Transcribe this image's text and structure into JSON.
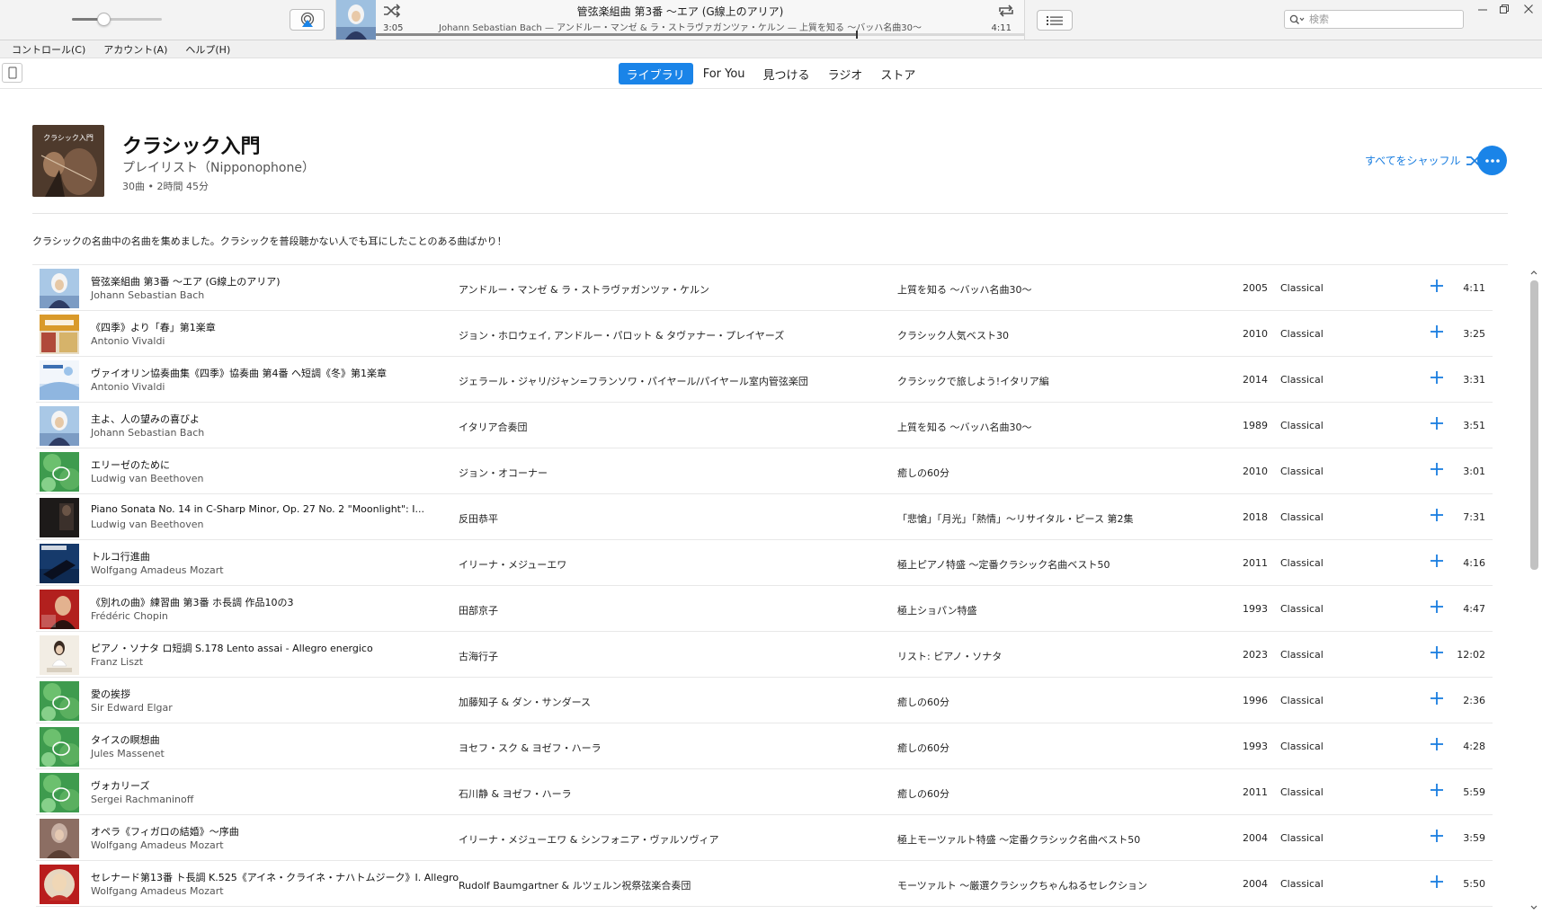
{
  "player": {
    "elapsed": "3:05",
    "remaining": "4:11",
    "title": "管弦楽組曲 第3番 ～エア (G線上のアリア)",
    "subtitle": "Johann Sebastian Bach — アンドルー・マンゼ & ラ・ストラヴァガンツァ・ケルン — 上質を知る ～バッハ名曲30～",
    "progress": 0.74,
    "volume": 0.35
  },
  "search": {
    "placeholder": "検索"
  },
  "menu": [
    "コントロール(C)",
    "アカウント(A)",
    "ヘルプ(H)"
  ],
  "nav": {
    "tabs": [
      {
        "label": "ライブラリ",
        "active": true
      },
      {
        "label": "For You",
        "active": false
      },
      {
        "label": "見つける",
        "active": false
      },
      {
        "label": "ラジオ",
        "active": false
      },
      {
        "label": "ストア",
        "active": false
      }
    ]
  },
  "playlist": {
    "art_text": "クラシック入門",
    "title": "クラシック入門",
    "subtitle": "プレイリスト（Nipponophone）",
    "meta": "30曲 • 2時間 45分",
    "shuffle_label": "すべてをシャッフル",
    "description": "クラシックの名曲中の名曲を集めました。クラシックを普段聴かない人でも耳にしたことのある曲ばかり！"
  },
  "colors": {
    "accent": "#1a84e8",
    "link": "#1a7ee0"
  },
  "tracks": [
    {
      "name": "管弦楽組曲 第3番 ～エア (G線上のアリア)",
      "composer": "Johann Sebastian Bach",
      "artist": "アンドルー・マンゼ & ラ・ストラヴァガンツァ・ケルン",
      "album": "上質を知る ～バッハ名曲30～",
      "year": "2005",
      "genre": "Classical",
      "duration": "4:11",
      "art": "bach"
    },
    {
      "name": "《四季》より「春」第1楽章",
      "composer": "Antonio Vivaldi",
      "artist": "ジョン・ホロウェイ, アンドルー・パロット & タヴァナー・プレイヤーズ",
      "album": "クラシック人気ベスト30",
      "year": "2010",
      "genre": "Classical",
      "duration": "3:25",
      "art": "classicbest"
    },
    {
      "name": "ヴァイオリン協奏曲集《四季》協奏曲 第4番 ヘ短調《冬》第1楽章",
      "composer": "Antonio Vivaldi",
      "artist": "ジェラール・ジャリ/ジャン=フランソワ・パイヤール/パイヤール室内管弦楽団",
      "album": "クラシックで旅しよう!イタリア編",
      "year": "2014",
      "genre": "Classical",
      "duration": "3:31",
      "art": "italy"
    },
    {
      "name": "主よ、人の望みの喜びよ",
      "composer": "Johann Sebastian Bach",
      "artist": "イタリア合奏団",
      "album": "上質を知る ～バッハ名曲30～",
      "year": "1989",
      "genre": "Classical",
      "duration": "3:51",
      "art": "bach"
    },
    {
      "name": "エリーゼのために",
      "composer": "Ludwig van Beethoven",
      "artist": "ジョン・オコーナー",
      "album": "癒しの60分",
      "year": "2010",
      "genre": "Classical",
      "duration": "3:01",
      "art": "green60"
    },
    {
      "name": "Piano Sonata No. 14 in C-Sharp Minor, Op. 27 No. 2 \"Moonlight\": I...",
      "composer": "Ludwig van Beethoven",
      "artist": "反田恭平",
      "album": "「悲愴」「月光」「熱情」～リサイタル・ピース 第2集",
      "year": "2018",
      "genre": "Classical",
      "duration": "7:31",
      "art": "dark"
    },
    {
      "name": "トルコ行進曲",
      "composer": "Wolfgang Amadeus Mozart",
      "artist": "イリーナ・メジューエワ",
      "album": "極上ピアノ特盛 ～定番クラシック名曲ベスト50",
      "year": "2011",
      "genre": "Classical",
      "duration": "4:16",
      "art": "piano"
    },
    {
      "name": "《別れの曲》練習曲 第3番 ホ長調 作品10の3",
      "composer": "Frédéric Chopin",
      "artist": "田部京子",
      "album": "極上ショパン特盛",
      "year": "1993",
      "genre": "Classical",
      "duration": "4:47",
      "art": "chopin"
    },
    {
      "name": "ピアノ・ソナタ ロ短調 S.178 Lento assai - Allegro energico",
      "composer": "Franz Liszt",
      "artist": "古海行子",
      "album": "リスト: ピアノ・ソナタ",
      "year": "2023",
      "genre": "Classical",
      "duration": "12:02",
      "art": "liszt"
    },
    {
      "name": "愛の挨拶",
      "composer": "Sir Edward Elgar",
      "artist": "加藤知子 & ダン・サンダース",
      "album": "癒しの60分",
      "year": "1996",
      "genre": "Classical",
      "duration": "2:36",
      "art": "green60"
    },
    {
      "name": "タイスの瞑想曲",
      "composer": "Jules Massenet",
      "artist": "ヨセフ・スク & ヨゼフ・ハーラ",
      "album": "癒しの60分",
      "year": "1993",
      "genre": "Classical",
      "duration": "4:28",
      "art": "green60"
    },
    {
      "name": "ヴォカリーズ",
      "composer": "Sergei Rachmaninoff",
      "artist": "石川静 & ヨゼフ・ハーラ",
      "album": "癒しの60分",
      "year": "2011",
      "genre": "Classical",
      "duration": "5:59",
      "art": "green60"
    },
    {
      "name": "オペラ《フィガロの結婚》～序曲",
      "composer": "Wolfgang Amadeus Mozart",
      "artist": "イリーナ・メジューエワ & シンフォニア・ヴァルソヴィア",
      "album": "極上モーツァルト特盛 ～定番クラシック名曲ベスト50",
      "year": "2004",
      "genre": "Classical",
      "duration": "3:59",
      "art": "mozart"
    },
    {
      "name": "セレナード第13番 ト長調 K.525《アイネ・クライネ・ナハトムジーク》I. Allegro",
      "composer": "Wolfgang Amadeus Mozart",
      "artist": "Rudolf Baumgartner & ルツェルン祝祭弦楽合奏団",
      "album": "モーツァルト ～厳選クラシックちゃんねるセレクション",
      "year": "2004",
      "genre": "Classical",
      "duration": "5:50",
      "art": "mozartred"
    }
  ]
}
